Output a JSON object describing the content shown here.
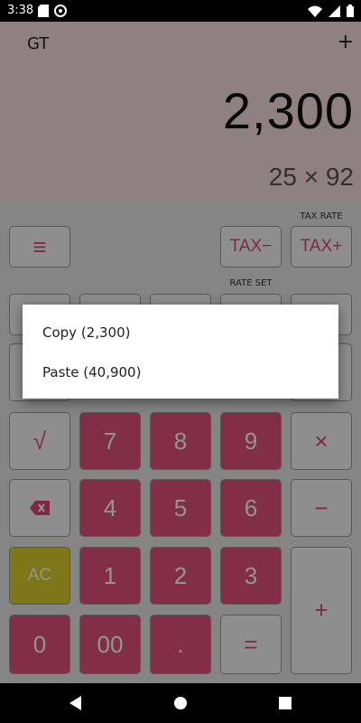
{
  "status_bar": {
    "time": "3:38",
    "left_icons": [
      "sd-card-icon",
      "sync-icon"
    ],
    "right_icons": [
      "wifi-icon",
      "signal-icon",
      "battery-icon"
    ]
  },
  "display": {
    "gt_label": "GT",
    "operator_indicator": "+",
    "main_value": "2,300",
    "expression": "25 × 92"
  },
  "labels": {
    "tax_rate": "TAX RATE",
    "rate_set": "RATE SET"
  },
  "keys": {
    "menu": "≡",
    "tax_minus": "TAX−",
    "tax_plus": "TAX+",
    "sqrt": "√",
    "multiply": "×",
    "minus": "−",
    "plus": "+",
    "equals": "=",
    "ac": "AC",
    "backspace": "⌫",
    "decimal": ".",
    "d0": "0",
    "d00": "00",
    "d1": "1",
    "d2": "2",
    "d3": "3",
    "d4": "4",
    "d5": "5",
    "d6": "6",
    "d7": "7",
    "d8": "8",
    "d9": "9"
  },
  "context_menu": {
    "copy": "Copy (2,300)",
    "paste": "Paste (40,900)"
  },
  "colors": {
    "accent": "#e0507d",
    "ac_key": "#d9cd2c",
    "display_bg": "#f7dce4"
  }
}
